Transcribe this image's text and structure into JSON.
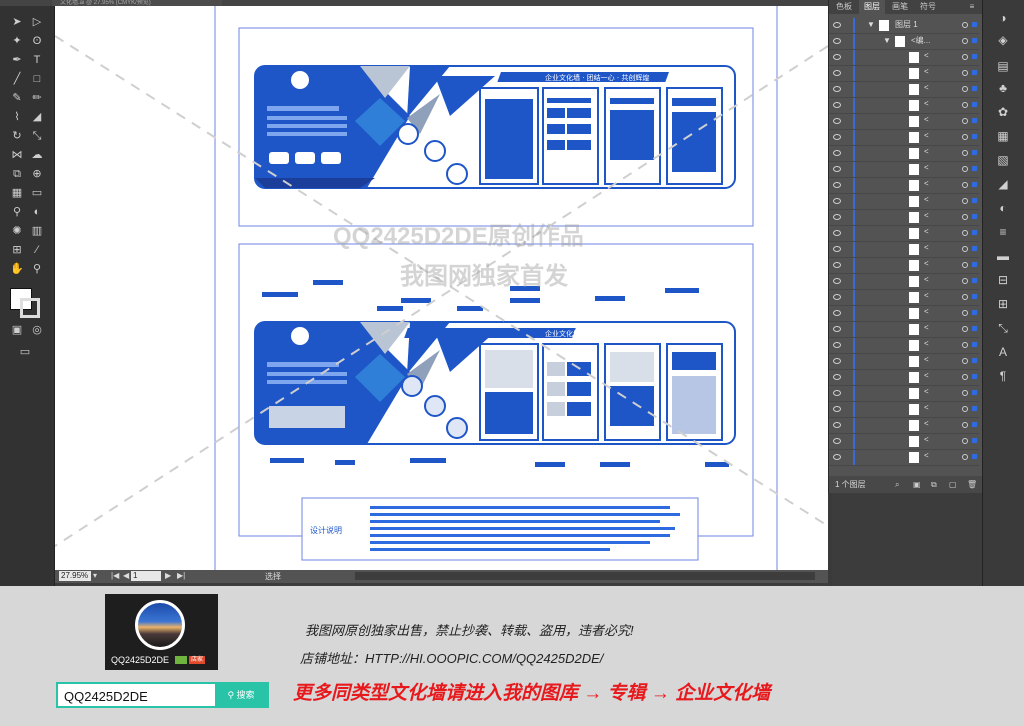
{
  "window": {
    "doc_tab": "文化墙.ai @ 27.95% (CMYK/预览)"
  },
  "toolbar": {
    "icons": [
      "selection-tool",
      "direct-selection-tool",
      "magic-wand",
      "lasso",
      "pen-tool",
      "type-tool",
      "line-tool",
      "rectangle-tool",
      "paintbrush",
      "pencil",
      "shaper",
      "eraser",
      "rotate",
      "scale",
      "width",
      "warp",
      "free-transform",
      "shape-builder",
      "perspective",
      "mesh",
      "gradient",
      "eyedropper",
      "blend",
      "symbol-sprayer",
      "graph",
      "artboard",
      "slice",
      "hand",
      "zoom"
    ]
  },
  "status": {
    "zoom": "27.95%",
    "artboard": "1",
    "mode": "选择"
  },
  "layers_panel": {
    "tabs": [
      "色板",
      "图层",
      "画笔",
      "符号"
    ],
    "layer_name": "图层 1",
    "group_name": "<编...",
    "item_label": "<",
    "footer": "1 个图层"
  },
  "canvas": {
    "wall_1": {
      "header": "企业文化墙 · 团结一心 · 共创辉煌"
    },
    "wall_2": {
      "header": "企业文化墙 · 团结一心 · 共创辉煌"
    },
    "note_title": "设计说明"
  },
  "watermark": {
    "line1": "QQ2425D2DE原创作品",
    "line2": "我图网独家首发"
  },
  "promo": {
    "profile_name": "QQ2425D2DE",
    "badge": "店家",
    "search_value": "QQ2425D2DE",
    "search_button": "搜索",
    "line1": "我图网原创独家出售，禁止抄袭、转载、盗用，违者必究!",
    "line2": "店铺地址：HTTP://HI.OOOPIC.COM/QQ2425D2DE/",
    "line3": "更多同类型文化墙请进入我的图库 → 专辑 → 企业文化墙"
  },
  "colors": {
    "accent_blue": "#1e56c8",
    "selection_blue": "#3a6ad8",
    "search_teal": "#29c3a8",
    "promo_red": "#e8191d"
  }
}
